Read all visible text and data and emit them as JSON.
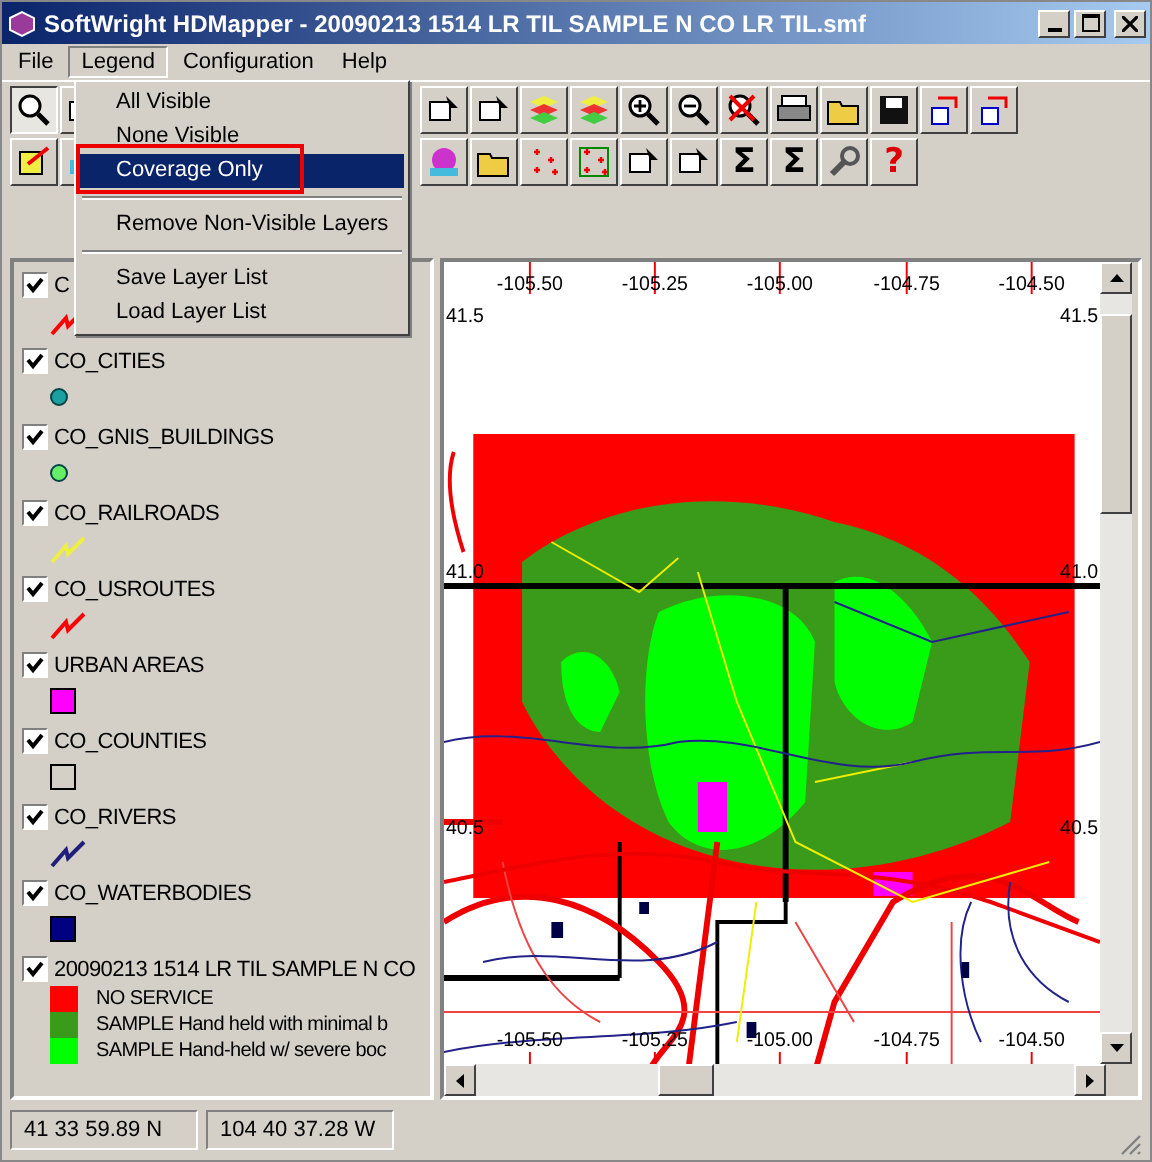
{
  "window": {
    "title": "SoftWright HDMapper - 20090213 1514 LR TIL SAMPLE N CO LR TIL.smf"
  },
  "menu_bar": [
    {
      "label": "File",
      "selected": false
    },
    {
      "label": "Legend",
      "selected": true
    },
    {
      "label": "Configuration",
      "selected": false
    },
    {
      "label": "Help",
      "selected": false
    }
  ],
  "legend_menu": [
    {
      "kind": "item",
      "label": "All Visible",
      "selected": false
    },
    {
      "kind": "item",
      "label": "None Visible",
      "selected": false
    },
    {
      "kind": "item",
      "label": "Coverage Only",
      "selected": true
    },
    {
      "kind": "separator"
    },
    {
      "kind": "item",
      "label": "Remove Non-Visible Layers",
      "selected": false
    },
    {
      "kind": "separator"
    },
    {
      "kind": "item",
      "label": "Save Layer List",
      "selected": false
    },
    {
      "kind": "item",
      "label": "Load Layer List",
      "selected": false
    }
  ],
  "toolbar_rows": [
    [
      {
        "kind": "icon",
        "pressed": true
      },
      {
        "kind": "icon",
        "pressed": false
      },
      {
        "kind": "icon",
        "pressed": false
      },
      {
        "kind": "icon",
        "pressed": false
      },
      {
        "kind": "icon",
        "pressed": false
      },
      {
        "kind": "icon",
        "pressed": false
      },
      {
        "kind": "icon",
        "pressed": false
      },
      {
        "kind": "icon",
        "pressed": false
      },
      {
        "kind": "icon",
        "pressed": false
      },
      {
        "kind": "icon",
        "pressed": false
      },
      {
        "kind": "icon",
        "pressed": false
      },
      {
        "kind": "icon",
        "pressed": false
      },
      {
        "kind": "icon",
        "pressed": false
      },
      {
        "kind": "icon",
        "pressed": false
      }
    ],
    [
      {
        "kind": "icon",
        "pressed": false
      },
      {
        "kind": "icon",
        "pressed": false
      },
      {
        "kind": "icon",
        "pressed": false
      },
      {
        "kind": "icon",
        "pressed": false
      },
      {
        "kind": "icon",
        "pressed": false
      },
      {
        "kind": "icon",
        "pressed": false
      },
      {
        "kind": "icon",
        "pressed": false
      },
      {
        "kind": "icon",
        "pressed": false
      },
      {
        "kind": "glyph",
        "text": "Σ",
        "pressed": false
      },
      {
        "kind": "glyph",
        "text": "Σ",
        "pressed": false
      },
      {
        "kind": "icon",
        "pressed": false
      },
      {
        "kind": "glyph",
        "text": "?",
        "pressed": false
      }
    ]
  ],
  "legend": {
    "layers": [
      {
        "label": "C",
        "checked": true,
        "kind": "line",
        "color": "#ff0000"
      },
      {
        "label": "CO_CITIES",
        "checked": true,
        "kind": "dot",
        "color": "#1aa0a0"
      },
      {
        "label": "CO_GNIS_BUILDINGS",
        "checked": true,
        "kind": "dot",
        "color": "#66ee66"
      },
      {
        "label": "CO_RAILROADS",
        "checked": true,
        "kind": "line",
        "color": "#eeee44"
      },
      {
        "label": "CO_USROUTES",
        "checked": true,
        "kind": "line",
        "color": "#ff0000"
      },
      {
        "label": "URBAN AREAS",
        "checked": true,
        "kind": "square",
        "color": "#ff00ff"
      },
      {
        "label": "CO_COUNTIES",
        "checked": true,
        "kind": "square",
        "color": "#d4d0c8"
      },
      {
        "label": "CO_RIVERS",
        "checked": true,
        "kind": "line",
        "color": "#20207a"
      },
      {
        "label": "CO_WATERBODIES",
        "checked": true,
        "kind": "square",
        "color": "#000080"
      },
      {
        "label": "20090213 1514 LR TIL SAMPLE N CO",
        "checked": true,
        "kind": "classes",
        "classes": [
          {
            "label": "NO SERVICE",
            "color": "#ff0000"
          },
          {
            "label": "SAMPLE Hand held with minimal b",
            "color": "#3a9a1a"
          },
          {
            "label": "SAMPLE Hand-held w/ severe boc",
            "color": "#00ff00"
          }
        ]
      }
    ]
  },
  "map": {
    "top_labels": [
      "-105.50",
      "-105.25",
      "-105.00",
      "-104.75",
      "-104.50"
    ],
    "bottom_labels": [
      "-105.50",
      "-105.25",
      "-105.00",
      "-104.75",
      "-104.50"
    ],
    "left_labels": [
      "41.5",
      "41.0",
      "40.5"
    ],
    "right_labels": [
      "41.5",
      "41.0",
      "40.5"
    ]
  },
  "status_bar": [
    "41 33 59.89 N",
    "104 40 37.28 W"
  ]
}
